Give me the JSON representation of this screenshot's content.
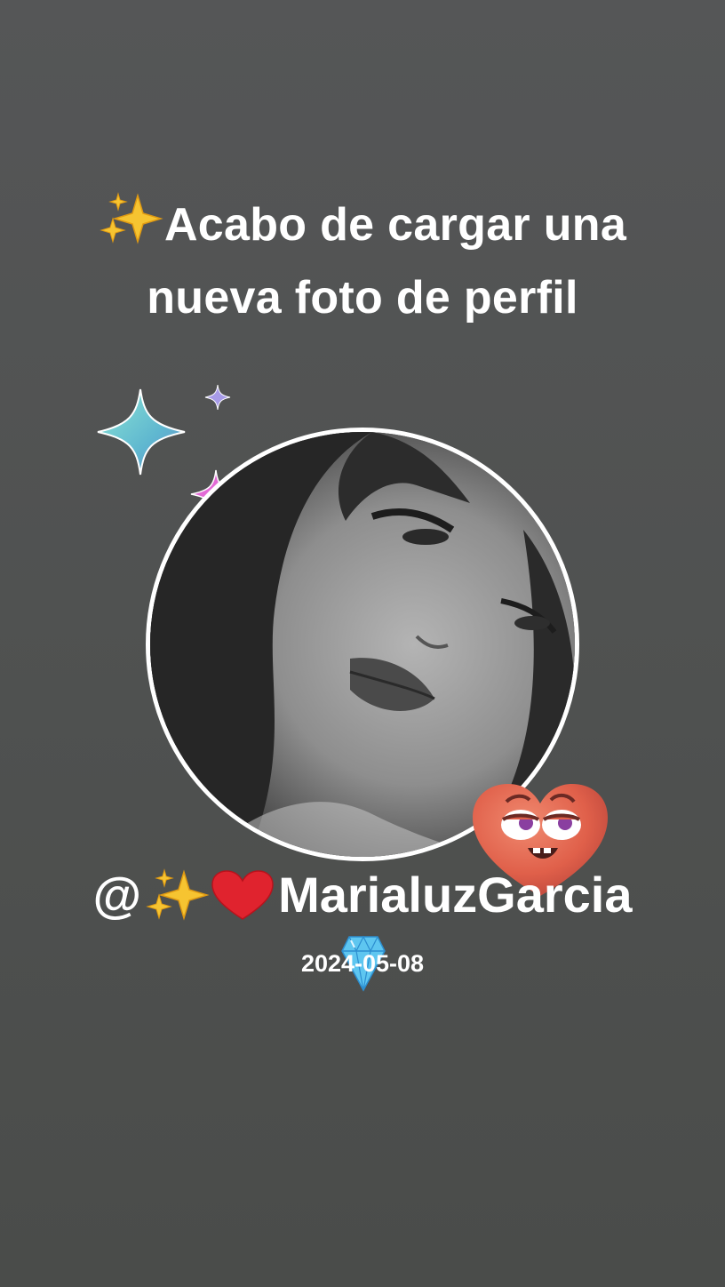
{
  "post": {
    "headline_line1": "Acabo de cargar una",
    "headline_line2": "nueva foto de perfil",
    "handle_prefix": "@",
    "username": "MarialuzGarcia",
    "date": "2024-05-08"
  },
  "icons": {
    "headline_sparkles": "sparkles-icon",
    "handle_sparkles": "sparkles-icon",
    "handle_heart": "red-heart-icon",
    "decorations": [
      "teal-sparkle-icon",
      "purple-sparkle-icon",
      "pink-sparkle-icon",
      "heart-face-icon",
      "gem-icon"
    ]
  },
  "colors": {
    "background": "#555657",
    "text": "#ffffff",
    "ring": "#ffffff",
    "heart": "#e0604a",
    "sparkle_gold": "#f6c431"
  }
}
